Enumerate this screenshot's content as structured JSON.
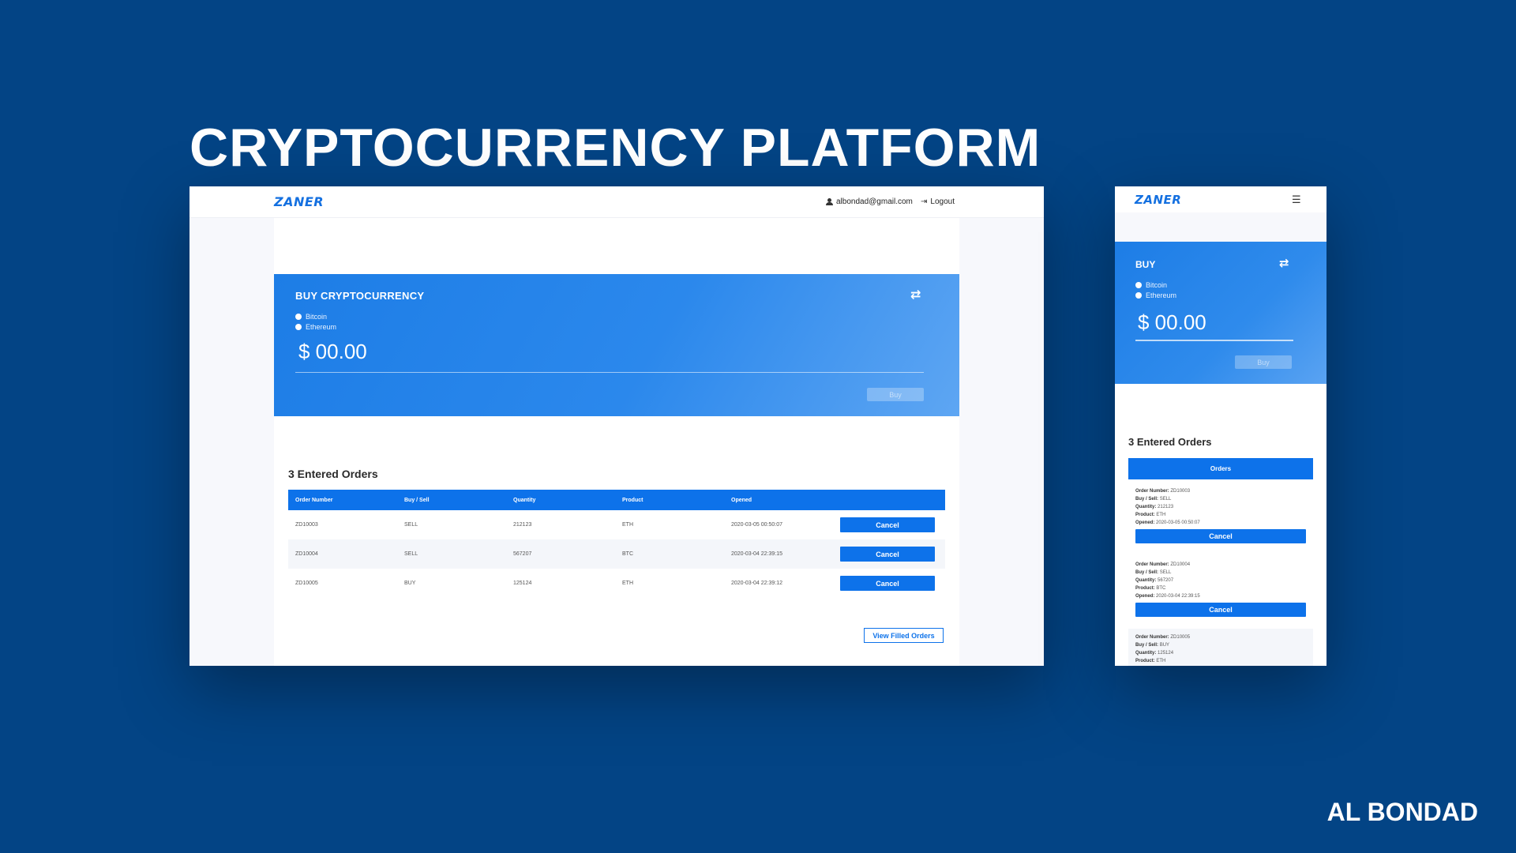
{
  "hero": {
    "title": "CRYPTOCURRENCY PLATFORM",
    "credit": "AL BONDAD"
  },
  "app": {
    "logo": "ZANER",
    "user_email": "albondad@gmail.com",
    "logout_label": "Logout",
    "menu_icon": "hamburger-icon"
  },
  "buy_panel": {
    "desktop_title": "BUY CRYPTOCURRENCY",
    "mobile_title": "BUY",
    "swap_icon": "swap-arrows-icon",
    "options": [
      "Bitcoin",
      "Ethereum"
    ],
    "amount": "$ 00.00",
    "buy_label": "Buy"
  },
  "orders": {
    "heading": "3 Entered Orders",
    "mobile_bar_label": "Orders",
    "columns": [
      "Order Number",
      "Buy / Sell",
      "Quantity",
      "Product",
      "Opened"
    ],
    "cancel_label": "Cancel",
    "view_filled_label": "View Filled Orders",
    "rows": [
      {
        "order_number": "ZD10003",
        "side": "SELL",
        "quantity": "212123",
        "product": "ETH",
        "opened": "2020-03-05 00:50:07"
      },
      {
        "order_number": "ZD10004",
        "side": "SELL",
        "quantity": "567207",
        "product": "BTC",
        "opened": "2020-03-04 22:39:15"
      },
      {
        "order_number": "ZD10005",
        "side": "BUY",
        "quantity": "125124",
        "product": "ETH",
        "opened": "2020-03-04 22:39:12"
      }
    ],
    "mobile_field_labels": {
      "order_number": "Order Number:",
      "side": "Buy / Sell:",
      "quantity": "Quantity:",
      "product": "Product:",
      "opened": "Opened:"
    }
  },
  "colors": {
    "background": "#034485",
    "accent": "#0d72ea",
    "logo": "#1470e0"
  }
}
